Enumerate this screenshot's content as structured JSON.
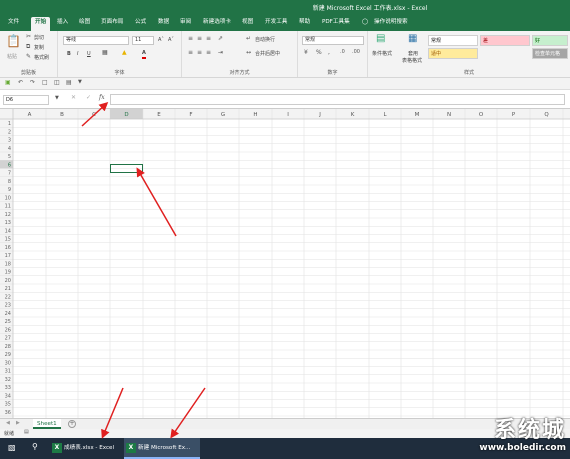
{
  "window": {
    "title": "新建 Microsoft Excel 工作表.xlsx - Excel"
  },
  "tabs": [
    {
      "label": "文件"
    },
    {
      "label": "开始"
    },
    {
      "label": "插入"
    },
    {
      "label": "绘图"
    },
    {
      "label": "页面布局"
    },
    {
      "label": "公式"
    },
    {
      "label": "数据"
    },
    {
      "label": "审阅"
    },
    {
      "label": "新建选项卡"
    },
    {
      "label": "视图"
    },
    {
      "label": "开发工具"
    },
    {
      "label": "帮助"
    },
    {
      "label": "PDF工具集"
    }
  ],
  "tell_me": "操作说明搜索",
  "clipboard": {
    "paste": "粘贴",
    "cut": "剪切",
    "copy": "复制",
    "format_painter": "格式刷",
    "group": "剪贴板"
  },
  "font": {
    "name": "等线",
    "size": "11",
    "bold": "B",
    "italic": "I",
    "underline": "U",
    "font_color_glyph": "A",
    "group": "字体"
  },
  "alignment": {
    "wrap": "自动换行",
    "merge": "合并后居中",
    "group": "对齐方式"
  },
  "number": {
    "format": "常规",
    "group": "数字"
  },
  "styles": {
    "conditional": "条件格式",
    "table": "套用",
    "table2": "表格格式",
    "normal": "常规",
    "bad": "差",
    "good": "好",
    "neutral": "适中",
    "check": "检查单元格",
    "group": "样式"
  },
  "colors": {
    "accent": "#217346",
    "bad": "#ffc7ce",
    "good": "#c6efce",
    "neutral": "#ffeb9c",
    "check": "#a5a5a5"
  },
  "name_box": "D6",
  "fx_label": "fx",
  "columns": [
    "A",
    "B",
    "C",
    "D",
    "E",
    "F",
    "G",
    "H",
    "I",
    "J",
    "K",
    "L",
    "M",
    "N",
    "O",
    "P",
    "Q"
  ],
  "rows": [
    "1",
    "2",
    "3",
    "4",
    "5",
    "6",
    "7",
    "8",
    "9",
    "10",
    "11",
    "12",
    "13",
    "14",
    "15",
    "16",
    "17",
    "18",
    "19",
    "20",
    "21",
    "22",
    "23",
    "24",
    "25",
    "26",
    "27",
    "28",
    "29",
    "30",
    "31",
    "32",
    "33",
    "34",
    "35",
    "36",
    "37"
  ],
  "sheet": {
    "name": "Sheet1",
    "add": "+"
  },
  "status": {
    "ready": "就绪"
  },
  "taskbar": [
    {
      "label": "成绩表.xlsx - Excel"
    },
    {
      "label": "新建 Microsoft Ex..."
    }
  ],
  "watermark": {
    "brand": "系统城",
    "url": "www.boledir.com"
  }
}
